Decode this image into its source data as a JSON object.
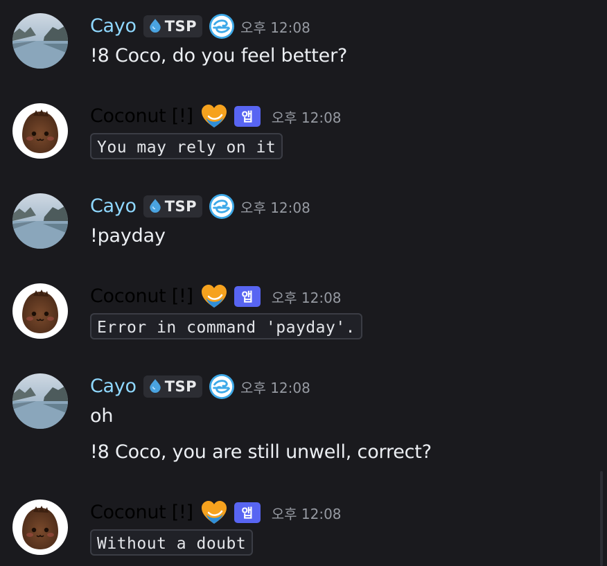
{
  "messages": [
    {
      "author": "Cayo",
      "tag": "TSP",
      "time": "오후 12:08",
      "lines": [
        "!8 Coco, do you feel better?"
      ]
    },
    {
      "author": "Coconut [!]",
      "app_badge": "앱",
      "time": "오후 12:08",
      "code": "You may rely on it"
    },
    {
      "author": "Cayo",
      "tag": "TSP",
      "time": "오후 12:08",
      "lines": [
        "!payday"
      ]
    },
    {
      "author": "Coconut [!]",
      "app_badge": "앱",
      "time": "오후 12:08",
      "code": "Error in command 'payday'."
    },
    {
      "author": "Cayo",
      "tag": "TSP",
      "time": "오후 12:08",
      "lines": [
        "oh",
        "!8 Coco, you are still unwell, correct?"
      ]
    },
    {
      "author": "Coconut [!]",
      "app_badge": "앱",
      "time": "오후 12:08",
      "code": "Without a doubt"
    }
  ],
  "colors": {
    "background": "#1a1a1e",
    "cayo_name": "#8fd8ff",
    "coconut_name": "#000000",
    "app_badge": "#5865f2"
  },
  "icons": {
    "tag_icon": "water-drop-icon",
    "cayo_role_icon": "wind-swirl-icon",
    "coconut_role_icon": "heart-icon"
  }
}
